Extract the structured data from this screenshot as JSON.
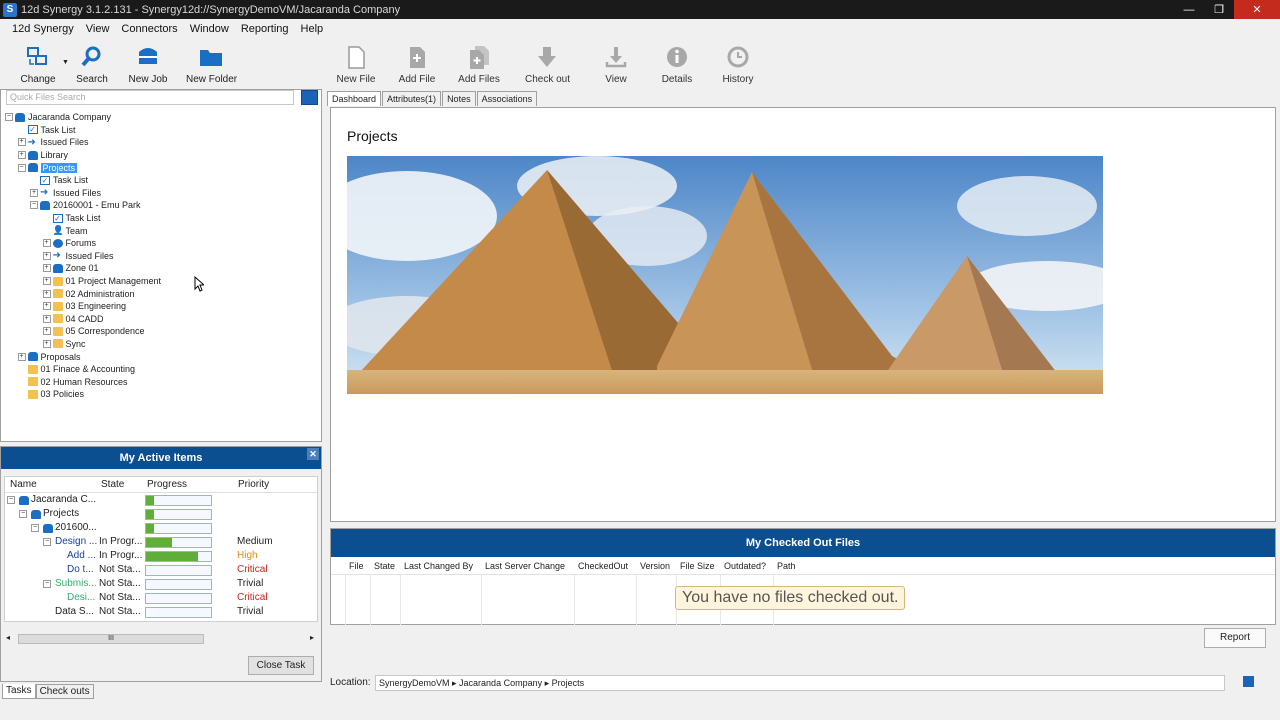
{
  "window": {
    "title": "12d Synergy 3.1.2.131 - Synergy12d://SynergyDemoVM/Jacaranda Company",
    "app_icon": "12d-synergy-app-icon",
    "controls": {
      "minimize": "—",
      "maximize": "❐",
      "close": "✕"
    }
  },
  "menu": [
    "12d Synergy",
    "View",
    "Connectors",
    "Window",
    "Reporting",
    "Help"
  ],
  "toolbar": {
    "change": "Change",
    "search": "Search",
    "new_job": "New Job",
    "new_folder": "New Folder",
    "new_file": "New File",
    "add_file": "Add File",
    "add_files": "Add Files",
    "check_out": "Check out",
    "view": "View",
    "details": "Details",
    "history": "History"
  },
  "quick_search": {
    "placeholder": "Quick Files Search"
  },
  "tree": [
    {
      "label": "Jacaranda Company",
      "icon": "cabinet",
      "depth": 0,
      "exp": "−"
    },
    {
      "label": "Task List",
      "icon": "check",
      "depth": 1,
      "exp": ""
    },
    {
      "label": "Issued Files",
      "icon": "arrow",
      "depth": 1,
      "exp": "+"
    },
    {
      "label": "Library",
      "icon": "cabinet",
      "depth": 1,
      "exp": "+"
    },
    {
      "label": "Projects",
      "icon": "cabinet",
      "depth": 1,
      "exp": "−",
      "selected": true
    },
    {
      "label": "Task List",
      "icon": "check",
      "depth": 2,
      "exp": ""
    },
    {
      "label": "Issued Files",
      "icon": "arrow",
      "depth": 2,
      "exp": "+"
    },
    {
      "label": "20160001 - Emu Park",
      "icon": "cabinet",
      "depth": 2,
      "exp": "−"
    },
    {
      "label": "Task List",
      "icon": "check",
      "depth": 3,
      "exp": ""
    },
    {
      "label": "Team",
      "icon": "person",
      "depth": 3,
      "exp": ""
    },
    {
      "label": "Forums",
      "icon": "forum",
      "depth": 3,
      "exp": "+"
    },
    {
      "label": "Issued Files",
      "icon": "arrow",
      "depth": 3,
      "exp": "+"
    },
    {
      "label": "Zone 01",
      "icon": "cabinet",
      "depth": 3,
      "exp": "+"
    },
    {
      "label": "01 Project Management",
      "icon": "folder",
      "depth": 3,
      "exp": "+"
    },
    {
      "label": "02 Administration",
      "icon": "folder",
      "depth": 3,
      "exp": "+"
    },
    {
      "label": "03 Engineering",
      "icon": "folder",
      "depth": 3,
      "exp": "+"
    },
    {
      "label": "04 CADD",
      "icon": "folder",
      "depth": 3,
      "exp": "+"
    },
    {
      "label": "05 Correspondence",
      "icon": "folder",
      "depth": 3,
      "exp": "+"
    },
    {
      "label": "Sync",
      "icon": "folder",
      "depth": 3,
      "exp": "+"
    },
    {
      "label": "Proposals",
      "icon": "cabinet",
      "depth": 1,
      "exp": "+"
    },
    {
      "label": "01 Finace & Accounting",
      "icon": "folder",
      "depth": 1,
      "exp": ""
    },
    {
      "label": "02 Human Resources",
      "icon": "folder",
      "depth": 1,
      "exp": ""
    },
    {
      "label": "03 Policies",
      "icon": "folder",
      "depth": 1,
      "exp": ""
    }
  ],
  "active_items": {
    "title": "My Active Items",
    "close_glyph": "✕",
    "columns": {
      "name": "Name",
      "state": "State",
      "progress": "Progress",
      "priority": "Priority"
    },
    "rows": [
      {
        "name": "Jacaranda C...",
        "state": "",
        "progress": 0.12,
        "priority": "",
        "indent": 0,
        "exp": "−",
        "icon": "cabinet",
        "color": "#222222",
        "pcolor": "#222222"
      },
      {
        "name": "Projects",
        "state": "",
        "progress": 0.12,
        "priority": "",
        "indent": 1,
        "exp": "−",
        "icon": "cabinet",
        "color": "#222222",
        "pcolor": "#222222"
      },
      {
        "name": "201600...",
        "state": "",
        "progress": 0.12,
        "priority": "",
        "indent": 2,
        "exp": "−",
        "icon": "cabinet",
        "color": "#222222",
        "pcolor": "#222222"
      },
      {
        "name": "Design ...",
        "state": "In Progr...",
        "progress": 0.4,
        "priority": "Medium",
        "indent": 3,
        "exp": "−",
        "icon": "",
        "color": "#1a3fa8",
        "pcolor": "#222222"
      },
      {
        "name": "Add ...",
        "state": "In Progr...",
        "progress": 0.8,
        "priority": "High",
        "indent": 4,
        "exp": "",
        "icon": "",
        "color": "#1a3fa8",
        "pcolor": "#e08a1a"
      },
      {
        "name": "Do t...",
        "state": "Not Sta...",
        "progress": 0,
        "priority": "Critical",
        "indent": 4,
        "exp": "",
        "icon": "",
        "color": "#1a3fa8",
        "pcolor": "#d02020"
      },
      {
        "name": "Submis...",
        "state": "Not Sta...",
        "progress": 0,
        "priority": "Trivial",
        "indent": 3,
        "exp": "−",
        "icon": "",
        "color": "#2fb06a",
        "pcolor": "#222222"
      },
      {
        "name": "Desi...",
        "state": "Not Sta...",
        "progress": 0,
        "priority": "Critical",
        "indent": 4,
        "exp": "",
        "icon": "",
        "color": "#2fb06a",
        "pcolor": "#d02020"
      },
      {
        "name": "Data S...",
        "state": "Not Sta...",
        "progress": 0,
        "priority": "Trivial",
        "indent": 3,
        "exp": "",
        "icon": "",
        "color": "#222222",
        "pcolor": "#222222"
      }
    ],
    "close_task": "Close Task",
    "scroll_thumb_glyph": "III",
    "scroll_left": "◂",
    "scroll_right": "▸"
  },
  "bottom_tabs": [
    "Tasks",
    "Check outs"
  ],
  "content_tabs": [
    "Dashboard",
    "Attributes(1)",
    "Notes",
    "Associations"
  ],
  "dashboard": {
    "title": "Projects",
    "banner": "pyramids-photo"
  },
  "checked_out": {
    "title": "My Checked Out Files",
    "columns": [
      "File",
      "State",
      "Last Changed By",
      "Last Server Change",
      "CheckedOut",
      "Version",
      "File Size",
      "Outdated?",
      "Path"
    ],
    "empty_message": "You have no files checked out."
  },
  "report": "Report",
  "location": {
    "label": "Location:",
    "value": "SynergyDemoVM ▸ Jacaranda Company ▸ Projects"
  },
  "colors": {
    "accent": "#0c4f91",
    "folder": "#f2c14e",
    "cabinet": "#1a6fc4",
    "progress": "#5fae3a"
  }
}
